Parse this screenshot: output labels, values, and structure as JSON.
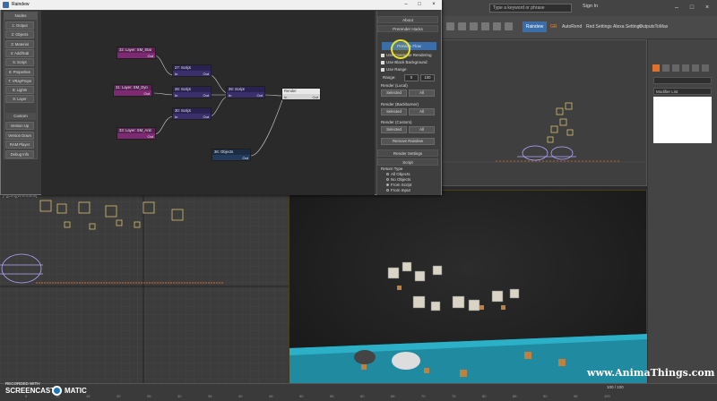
{
  "max": {
    "search_placeholder": "Type a keyword or phrase",
    "sign_in": "Sign In",
    "toolbar": {
      "raindew": "Raindew",
      "gr": "GR",
      "autorend": "AutoRend",
      "redsettings": "Red Settings",
      "alexa": "Alexa Settings",
      "outputs": "OutputsToMax"
    },
    "modifier_list": "Modifier List",
    "viewport_label": "[+][Camera][Realistic]",
    "viewport_left_label": "[+][Left][Wireframe]",
    "frame_counter": "100 / 100",
    "ticks": [
      "5",
      "10",
      "15",
      "20",
      "25",
      "30",
      "35",
      "40",
      "45",
      "50",
      "55",
      "60",
      "65",
      "70",
      "75",
      "80",
      "85",
      "90",
      "95",
      "100"
    ]
  },
  "raindew": {
    "title": "Raindew",
    "nodes_header": "Nodes",
    "nodes": [
      "1: Output",
      "2: Objects",
      "3: Material",
      "4: Add/Sub",
      "5: Script",
      "6: Properties",
      "7: VRayProps",
      "8: Lights",
      "9: Layer"
    ],
    "custom_header": "Custom",
    "custom": [
      "Version Up",
      "Version Down",
      "RAM Player",
      "Debug Info"
    ],
    "graph_nodes": {
      "layer32": {
        "title": "32: Layer: SM_Stat",
        "out": "Out"
      },
      "layer31": {
        "title": "31: Layer: SM_Dyn",
        "out": "Out"
      },
      "layer33": {
        "title": "33: Layer: SM_Anit",
        "out": "Out"
      },
      "script27": {
        "title": "27: Script",
        "in": "In",
        "out": "Out"
      },
      "script26": {
        "title": "26: Script",
        "in": "In",
        "out": "Out"
      },
      "script30": {
        "title": "30: Script",
        "in": "In",
        "out": "Out"
      },
      "script28": {
        "title": "28: Script",
        "in": "In",
        "out": "Out"
      },
      "objects36": {
        "title": "36: Objects",
        "out": "Out"
      },
      "render": {
        "title": "Render",
        "in": "In",
        "out": "Out"
      }
    },
    "right": {
      "about": "About",
      "prerender": "Prerender Hacks",
      "preview": "Preview Flow",
      "opts": [
        "Use Overwrite Rendering",
        "Use Black Background",
        "Use Range"
      ],
      "range_label": "Range:",
      "range_from": "0",
      "range_to": "100",
      "render_local": "Render (Local)",
      "render_backburner": "Render (Backburner)",
      "render_custom": "Render (Custom)",
      "selected": "Selected",
      "all": "All",
      "remove": "Remove Raindew",
      "render_settings": "Render Settings",
      "script_hdr": "Script",
      "return_type": "Return Type",
      "return_opts": [
        "All Objects",
        "No Objects",
        "From Script",
        "From Input"
      ]
    }
  },
  "overlay": {
    "watermark": "www.AnimaThings.com",
    "recorded_with": "RECORDED WITH",
    "screencast": "SCREENCAST",
    "matic": "MATIC"
  }
}
